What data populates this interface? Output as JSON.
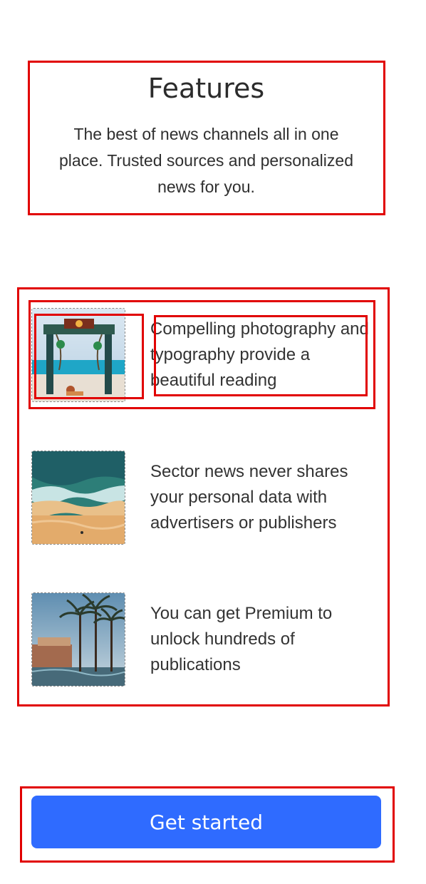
{
  "header": {
    "title": "Features",
    "subtitle": "The best of news channels all in one place. Trusted sources and personalized news for you."
  },
  "features": [
    {
      "text": "Compelling photography and typography provide a beautiful reading",
      "image_icon": "beach-swing-image"
    },
    {
      "text": "Sector news never shares your personal data with advertisers or publishers",
      "image_icon": "ocean-shore-image"
    },
    {
      "text": "You can get Premium to unlock hundreds of publications",
      "image_icon": "palm-resort-image"
    }
  ],
  "cta": {
    "label": "Get started"
  },
  "colors": {
    "primary": "#2f6bff",
    "annotation": "#e10000",
    "text": "#333333"
  }
}
